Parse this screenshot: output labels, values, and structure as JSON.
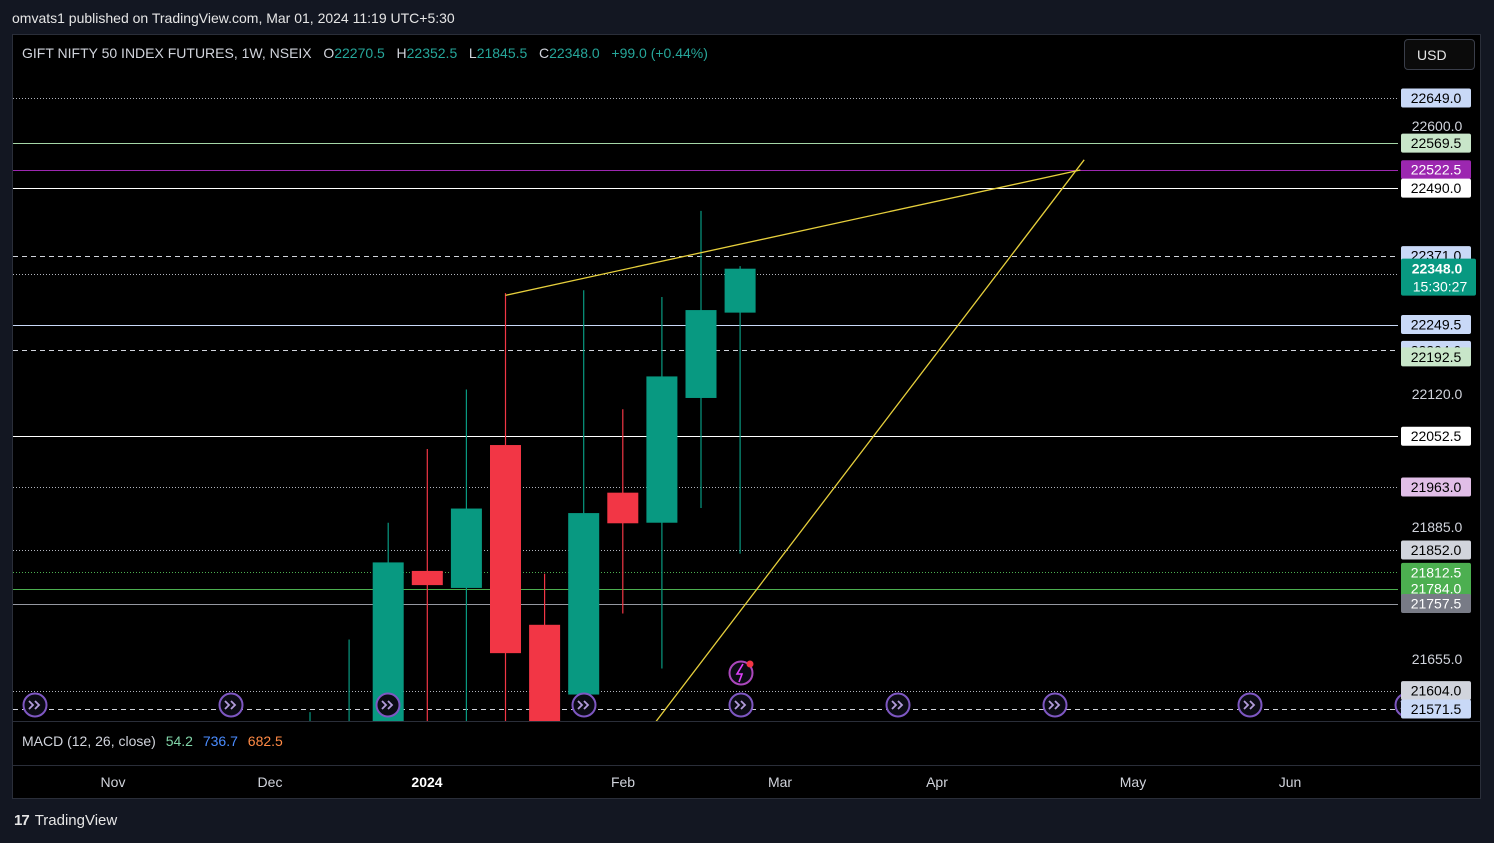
{
  "header": {
    "publish_line": "omvats1 published on TradingView.com, Mar 01, 2024 11:19 UTC+5:30"
  },
  "legend": {
    "symbol": "GIFT NIFTY 50 INDEX FUTURES, 1W, NSEIX",
    "o_label": "O",
    "o_value": "22270.5",
    "h_label": "H",
    "h_value": "22352.5",
    "l_label": "L",
    "l_value": "21845.5",
    "c_label": "C",
    "c_value": "22348.0",
    "change": "+99.0 (+0.44%)"
  },
  "currency_button": "USD",
  "indicator": {
    "name": "MACD (12, 26, close)",
    "macd": "54.2",
    "signal": "736.7",
    "hist": "682.5"
  },
  "footer": {
    "logo": "17",
    "brand": "TradingView"
  },
  "colors": {
    "up": "#089981",
    "down": "#f23645",
    "trendline": "#e6cf3c",
    "background": "#000000"
  },
  "chart_data": {
    "type": "candlestick",
    "timeframe": "1W",
    "ylim": [
      21546,
      22745
    ],
    "x_ticks": [
      "Nov",
      "Dec",
      "2024",
      "Feb",
      "Mar",
      "Apr",
      "May",
      "Jun"
    ],
    "candles": [
      {
        "o": 21548,
        "h": 21566,
        "l": 21545,
        "c": 21549
      },
      {
        "o": 21545,
        "h": 21694,
        "l": 21545,
        "c": 21547
      },
      {
        "o": 21550,
        "h": 21900,
        "l": 21545,
        "c": 21830
      },
      {
        "o": 21815,
        "h": 22030,
        "l": 21550,
        "c": 21790
      },
      {
        "o": 21785,
        "h": 22135,
        "l": 21545,
        "c": 21925
      },
      {
        "o": 22037,
        "h": 22305,
        "l": 21545,
        "c": 21670
      },
      {
        "o": 21720,
        "h": 21810,
        "l": 21545,
        "c": 21545
      },
      {
        "o": 21597,
        "h": 22310,
        "l": 21590,
        "c": 21917
      },
      {
        "o": 21953,
        "h": 22100,
        "l": 21740,
        "c": 21899
      },
      {
        "o": 21900,
        "h": 22298,
        "l": 21643,
        "c": 22158
      },
      {
        "o": 22120,
        "h": 22450,
        "l": 21926,
        "c": 22275
      },
      {
        "o": 22270.5,
        "h": 22352.5,
        "l": 21845.5,
        "c": 22348.0
      }
    ],
    "trendlines": [
      {
        "from": [
          5,
          22301
        ],
        "to": [
          19.7,
          22522
        ]
      },
      {
        "from": [
          8.8,
          21545
        ],
        "to": [
          19.8,
          22540
        ]
      }
    ],
    "price_axis_ticks": [
      "22600.0",
      "22120.0",
      "21885.0",
      "21655.0"
    ],
    "price_levels": [
      {
        "value": 22649.0,
        "label": "22649.0",
        "style": "dotted",
        "label_bg": "#c9d9f7",
        "label_fg": "#000000"
      },
      {
        "value": 22569.5,
        "label": "22569.5",
        "style": "solid",
        "line_color": "#a5d6a7",
        "label_bg": "#c8e6c9",
        "label_fg": "#000000"
      },
      {
        "value": 22522.5,
        "label": "22522.5",
        "style": "solid",
        "line_color": "#9c27b0",
        "label_bg": "#9c27b0",
        "label_fg": "#ffffff"
      },
      {
        "value": 22490.0,
        "label": "22490.0",
        "style": "solid",
        "line_color": "#ffffff",
        "label_bg": "#ffffff",
        "label_fg": "#000000"
      },
      {
        "value": 22371.0,
        "label": "22371.0",
        "style": "dashed",
        "label_bg": "#c9d9f7",
        "label_fg": "#000000"
      },
      {
        "value": 22339.5,
        "label": "22339.5",
        "style": "dotted",
        "label_bg": "#ffffff",
        "label_fg": "#000000"
      },
      {
        "value": 22249.5,
        "label": "22249.5",
        "style": "solid",
        "line_color": "#c9d9f7",
        "label_bg": "#c9d9f7",
        "label_fg": "#000000"
      },
      {
        "value": 22204.0,
        "label": "22204.0",
        "style": "dashed",
        "label_bg": "#c9d9f7",
        "label_fg": "#000000"
      },
      {
        "value": 22192.5,
        "label": "22192.5",
        "style": "none",
        "label_bg": "#c8e6c9",
        "label_fg": "#000000"
      },
      {
        "value": 22052.5,
        "label": "22052.5",
        "style": "solid",
        "line_color": "#ffffff",
        "label_bg": "#ffffff",
        "label_fg": "#000000"
      },
      {
        "value": 21963.0,
        "label": "21963.0",
        "style": "dotted",
        "label_bg": "#e1bee7",
        "label_fg": "#000000"
      },
      {
        "value": 21852.0,
        "label": "21852.0",
        "style": "dotted",
        "label_bg": "#d1d4dc",
        "label_fg": "#000000"
      },
      {
        "value": 21812.5,
        "label": "21812.5",
        "style": "dotted",
        "line_color": "#4caf50",
        "label_bg": "#4caf50",
        "label_fg": "#ffffff"
      },
      {
        "value": 21784.0,
        "label": "21784.0",
        "style": "solid",
        "line_color": "#4caf50",
        "label_bg": "#4caf50",
        "label_fg": "#ffffff"
      },
      {
        "value": 21757.5,
        "label": "21757.5",
        "style": "solid",
        "line_color": "#9598a1",
        "label_bg": "#787b86",
        "label_fg": "#ffffff"
      },
      {
        "value": 21604.0,
        "label": "21604.0",
        "style": "dotted",
        "label_bg": "#d1d4dc",
        "label_fg": "#000000"
      },
      {
        "value": 21571.5,
        "label": "21571.5",
        "style": "dashed",
        "label_bg": "#c9d9f7",
        "label_fg": "#000000"
      }
    ],
    "current_price": {
      "value": 22348.0,
      "label": "22348.0",
      "countdown": "15:30:27"
    }
  }
}
